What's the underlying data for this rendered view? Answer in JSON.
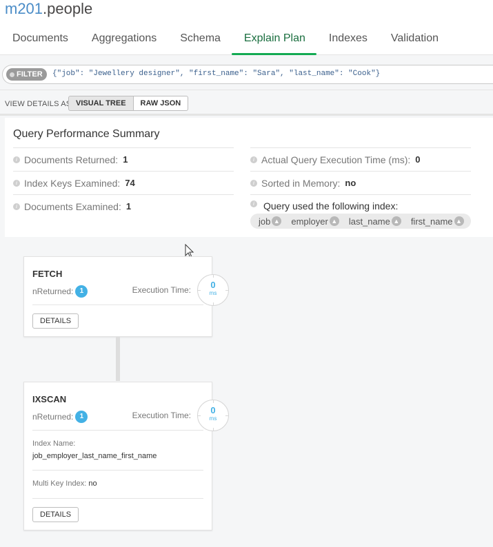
{
  "namespace": {
    "db": "m201",
    "collection": ".people"
  },
  "tabs": [
    {
      "label": "Documents"
    },
    {
      "label": "Aggregations"
    },
    {
      "label": "Schema"
    },
    {
      "label": "Explain Plan",
      "active": true
    },
    {
      "label": "Indexes"
    },
    {
      "label": "Validation"
    }
  ],
  "filter": {
    "label": "FILTER",
    "query": "{\"job\": \"Jewellery designer\", \"first_name\": \"Sara\", \"last_name\": \"Cook\"}"
  },
  "view": {
    "label": "VIEW DETAILS AS",
    "visual_tree": "VISUAL TREE",
    "raw_json": "RAW JSON"
  },
  "summary": {
    "title": "Query Performance Summary",
    "docs_returned_label": "Documents Returned:",
    "docs_returned": "1",
    "index_keys_label": "Index Keys Examined:",
    "index_keys": "74",
    "docs_examined_label": "Documents Examined:",
    "docs_examined": "1",
    "exec_time_label": "Actual Query Execution Time (ms):",
    "exec_time": "0",
    "sorted_label": "Sorted in Memory:",
    "sorted": "no",
    "index_used_label": "Query used the following index:",
    "index_fields": [
      "job",
      "employer",
      "last_name",
      "first_name"
    ]
  },
  "stages": {
    "fetch": {
      "name": "FETCH",
      "nreturned_label": "nReturned:",
      "nreturned": "1",
      "exec_label": "Execution Time:",
      "exec_value": "0",
      "exec_unit": "ms",
      "details": "DETAILS"
    },
    "ixscan": {
      "name": "IXSCAN",
      "nreturned_label": "nReturned:",
      "nreturned": "1",
      "exec_label": "Execution Time:",
      "exec_value": "0",
      "exec_unit": "ms",
      "index_name_label": "Index Name:",
      "index_name": "job_employer_last_name_first_name",
      "multikey_label": "Multi Key Index:",
      "multikey": "no",
      "details": "DETAILS"
    }
  },
  "colors": {
    "accent_green": "#13aa52",
    "namespace_blue": "#4a8cc7",
    "badge_blue": "#43b1e5"
  }
}
